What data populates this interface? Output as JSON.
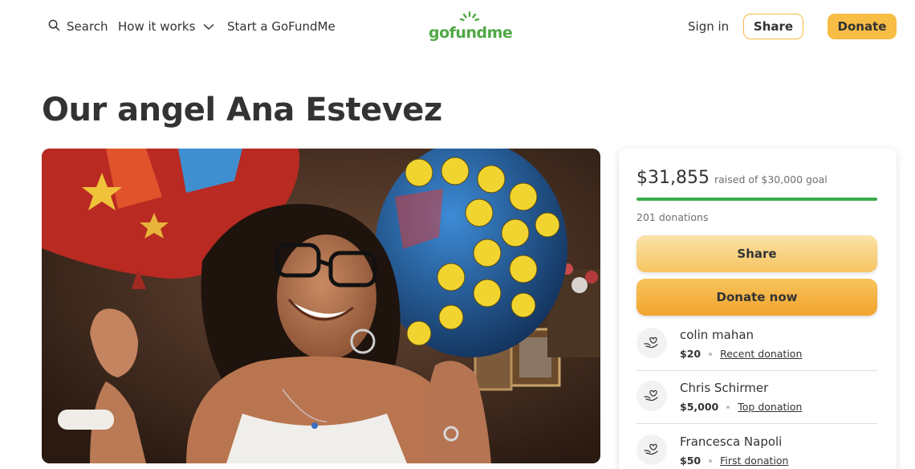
{
  "nav": {
    "search_label": "Search",
    "how_it_works_label": "How it works",
    "start_label": "Start a GoFundMe",
    "logo_text": "gofundme",
    "signin_label": "Sign in",
    "share_label": "Share",
    "donate_label": "Donate"
  },
  "campaign": {
    "title": "Our angel Ana Estevez"
  },
  "card": {
    "raised_amount": "$31,855",
    "raised_goal_text": "raised of $30,000 goal",
    "progress_fraction": 1.0,
    "donation_count": "201 donations",
    "share_label": "Share",
    "donate_now_label": "Donate now",
    "donors": [
      {
        "name": "colin mahan",
        "amount": "$20",
        "type": "Recent donation"
      },
      {
        "name": "Chris Schirmer",
        "amount": "$5,000",
        "type": "Top donation"
      },
      {
        "name": "Francesca Napoli",
        "amount": "$50",
        "type": "First donation"
      }
    ]
  },
  "colors": {
    "brand_green": "#3aaa4a",
    "accent_yellow": "#f7bd45",
    "text_dark": "#333333"
  },
  "icons": {
    "search": "search-icon",
    "chevron": "chevron-down-icon",
    "donor": "heart-hand-icon"
  }
}
